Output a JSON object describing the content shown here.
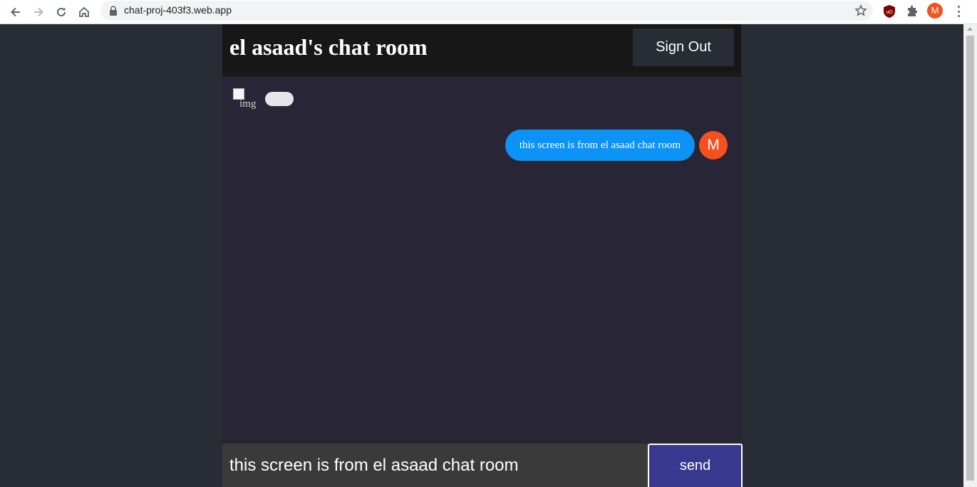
{
  "browser": {
    "url": "chat-proj-403f3.web.app",
    "profile_initial": "M",
    "icons": [
      "back-icon",
      "forward-icon",
      "reload-icon",
      "home-icon",
      "lock-icon",
      "star-icon",
      "ublock-icon",
      "extensions-icon",
      "menu-icon"
    ]
  },
  "header": {
    "title": "el asaad's chat room",
    "signout_label": "Sign Out"
  },
  "messages": [
    {
      "type": "received",
      "image_alt": "img",
      "text": ""
    },
    {
      "type": "sent",
      "text": "this screen is from el asaad chat room",
      "avatar_initial": "M"
    }
  ],
  "form": {
    "input_value": "this screen is from el asaad chat room",
    "send_label": "send"
  },
  "colors": {
    "page_bg": "#282c34",
    "header_bg": "#181717",
    "messages_bg": "#282636",
    "sent_bubble": "#0b93f6",
    "received_bubble": "#e5e5ea",
    "avatar": "#f4511e",
    "send_button": "#38388f",
    "input_bg": "#3a3a3a"
  }
}
